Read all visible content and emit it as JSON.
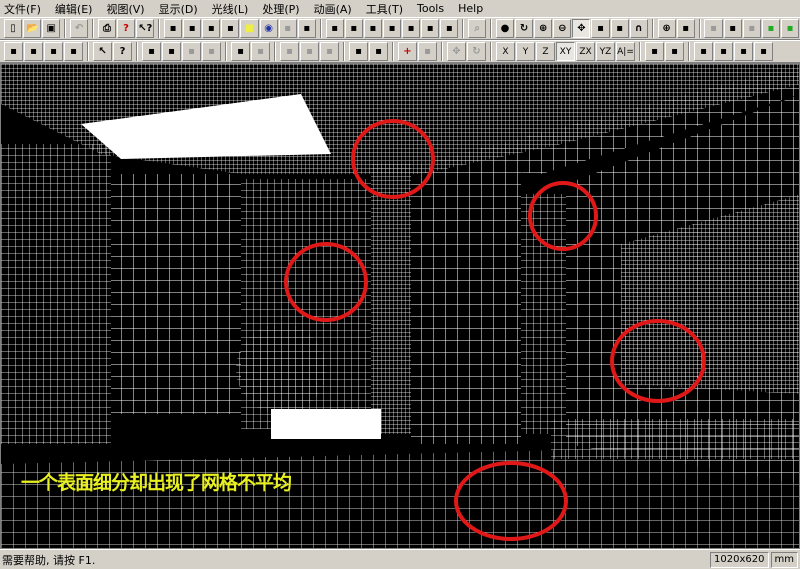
{
  "menu": [
    "文件(F)",
    "编辑(E)",
    "视图(V)",
    "显示(D)",
    "光线(L)",
    "处理(P)",
    "动画(A)",
    "工具(T)",
    "Tools",
    "Help"
  ],
  "toolbar1": [
    "new",
    "open",
    "save",
    "|",
    "undo-dis",
    "|",
    "print",
    "help",
    "context-help",
    "|",
    "g1",
    "g2",
    "g3",
    "g4",
    "yellow",
    "globe",
    "g7-dis",
    "g8",
    "|",
    "v1",
    "v2",
    "v3",
    "v4",
    "v5",
    "v6",
    "v7",
    "|",
    "zoom-dis",
    "|",
    "eye",
    "orbit",
    "zoom-in",
    "zoom-out",
    "pan-on",
    "walk",
    "fly",
    "rotate",
    "|",
    "zoom-window",
    "zoom-all",
    "|",
    "c1-dis",
    "c2",
    "c3-dis",
    "green-box",
    "green-box2"
  ],
  "toolbar2": [
    "l1",
    "l2",
    "l3",
    "l4",
    "|",
    "select",
    "query",
    "|",
    "s1",
    "s2",
    "s3-dis",
    "s4-dis",
    "|",
    "s5",
    "s6-dis",
    "|",
    "s7-dis",
    "s8-dis",
    "s9-dis",
    "|",
    "s10",
    "s11",
    "|",
    "cross",
    "s13-dis",
    "|",
    "move-dis",
    "rotate-dis",
    "|",
    "X",
    "Y",
    "Z",
    "XY",
    "ZX",
    "YZ",
    "A|=",
    "|",
    "e1",
    "e2",
    "|",
    "m1",
    "m2",
    "m3",
    "m4"
  ],
  "viewport": {
    "caption": "一个表面细分却出现了网格不平均"
  },
  "status": {
    "text": "需要帮助, 请按 F1.",
    "resolution": "1020x620",
    "unit": "mm"
  },
  "colors": {
    "annotation": "#e01818",
    "caption": "#e8f020"
  }
}
